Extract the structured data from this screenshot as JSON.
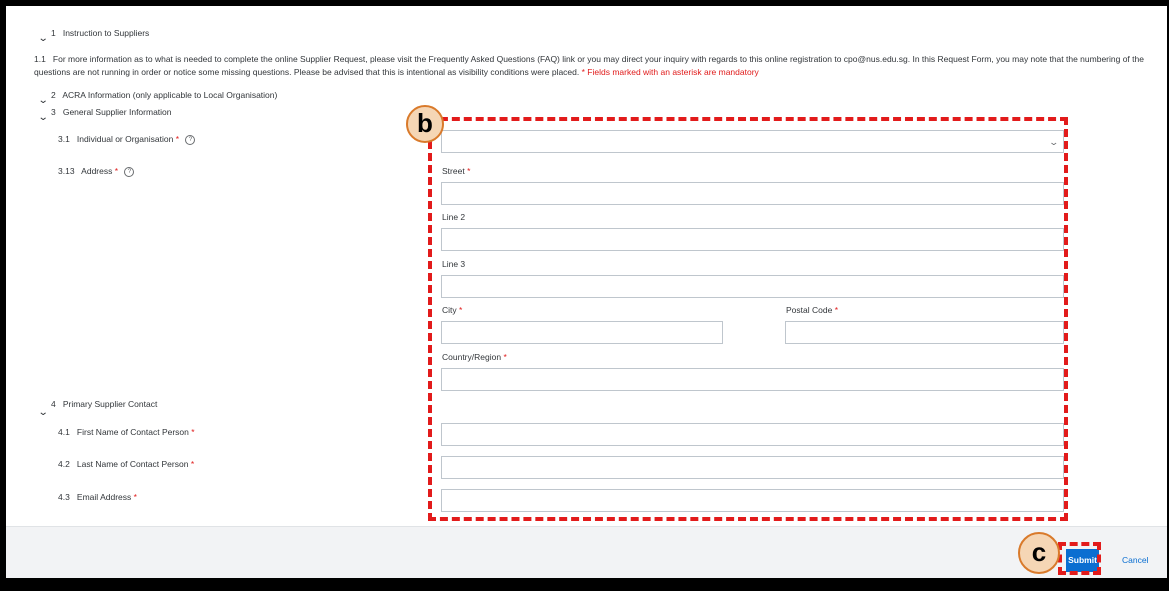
{
  "sections": {
    "s1": {
      "number": "1",
      "title": "Instruction to Suppliers"
    },
    "s2": {
      "number": "2",
      "title": "ACRA Information (only applicable to Local Organisation)"
    },
    "s3": {
      "number": "3",
      "title": "General Supplier Information"
    },
    "s4": {
      "number": "4",
      "title": "Primary Supplier Contact"
    }
  },
  "instructions": {
    "number": "1.1",
    "text": "For more information as to what is needed to complete the online Supplier Request, please visit the Frequently Asked Questions (FAQ) link or you may direct your inquiry with regards to this online registration to cpo@nus.edu.sg. In this Request Form, you may note that the numbering of the questions are not running in order or notice some missing questions. Please be advised that this is intentional as visibility conditions were placed.",
    "mandatory_note": "* Fields marked with an asterisk are mandatory"
  },
  "questions": {
    "q3_1": {
      "number": "3.1",
      "label": "Individual or Organisation",
      "required": "*",
      "help": "?"
    },
    "q3_13": {
      "number": "3.13",
      "label": "Address",
      "required": "*",
      "help": "?"
    },
    "q4_1": {
      "number": "4.1",
      "label": "First Name of Contact Person",
      "required": "*"
    },
    "q4_2": {
      "number": "4.2",
      "label": "Last Name of Contact Person",
      "required": "*"
    },
    "q4_3": {
      "number": "4.3",
      "label": "Email Address",
      "required": "*"
    }
  },
  "address": {
    "street": {
      "label": "Street",
      "required": "*",
      "value": ""
    },
    "line2": {
      "label": "Line 2",
      "value": ""
    },
    "line3": {
      "label": "Line 3",
      "value": ""
    },
    "city": {
      "label": "City",
      "required": "*",
      "value": ""
    },
    "postal": {
      "label": "Postal Code",
      "required": "*",
      "value": ""
    },
    "country": {
      "label": "Country/Region",
      "required": "*",
      "value": ""
    }
  },
  "select": {
    "value": "",
    "chevron": "chevron-down-icon"
  },
  "buttons": {
    "submit": "Submit",
    "cancel": "Cancel"
  },
  "callouts": {
    "b": "b",
    "c": "c"
  },
  "colors": {
    "accent": "#0a6ed1",
    "required": "#e01b1b",
    "annotation": "#e21b1b",
    "callout_fill": "#f5d6b5"
  }
}
